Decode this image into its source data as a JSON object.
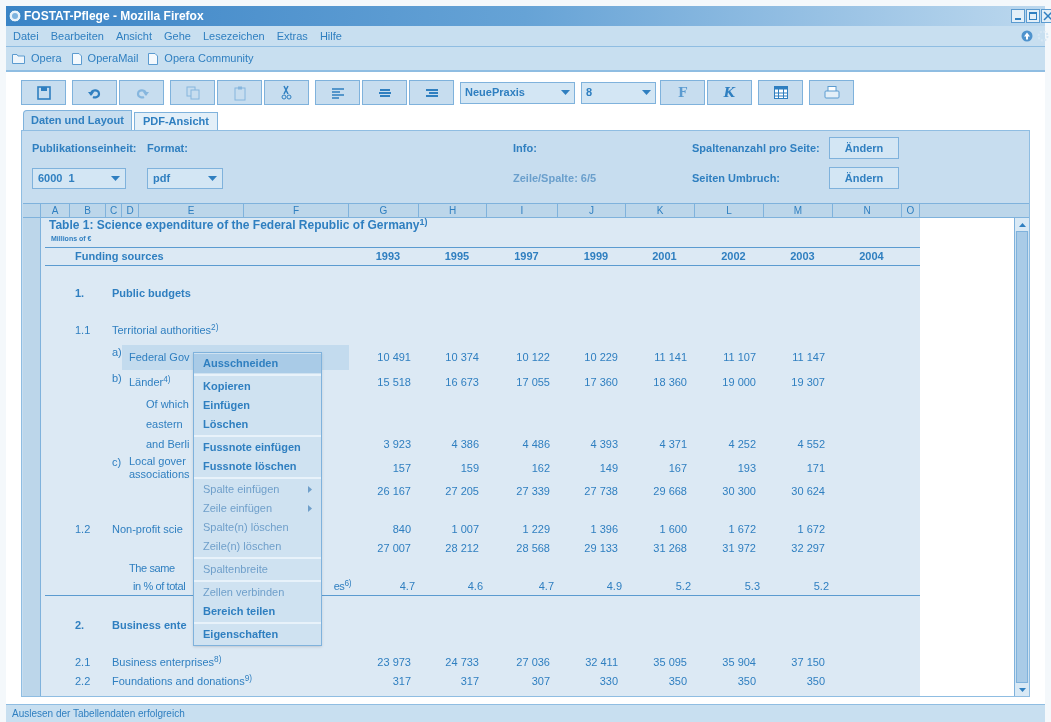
{
  "window": {
    "title": "FOSTAT-Pflege - Mozilla Firefox"
  },
  "menu": [
    "Datei",
    "Bearbeiten",
    "Ansicht",
    "Gehe",
    "Lesezeichen",
    "Extras",
    "Hilfe"
  ],
  "bookmarks": [
    {
      "kind": "folder",
      "label": "Opera"
    },
    {
      "kind": "page",
      "label": "OperaMail"
    },
    {
      "kind": "page",
      "label": "Opera Community"
    }
  ],
  "toolbar": {
    "font": "NeuePraxis",
    "size": "8",
    "bold": "F",
    "italic": "K"
  },
  "tabs": [
    {
      "label": "Daten und Layout",
      "selected": true
    },
    {
      "label": "PDF-Ansicht",
      "selected": false
    }
  ],
  "form": {
    "unit_label": "Publikationseinheit:",
    "unit_value": "6000  1",
    "format_label": "Format:",
    "format_value": "pdf",
    "info_label": "Info:",
    "info_value": "Zeile/Spalte: 6/5",
    "columns_label": "Spaltenanzahl pro Seite:",
    "columns_button": "Ändern",
    "break_label": "Seiten Umbruch:",
    "break_button": "Ändern"
  },
  "sheet": {
    "columns": [
      "A",
      "B",
      "C",
      "D",
      "E",
      "F",
      "G",
      "H",
      "I",
      "J",
      "K",
      "L",
      "M",
      "N",
      "O"
    ],
    "rows": [
      {
        "kind": "title",
        "text": "Table 1:  Science expenditure of the Federal Republic of Germany$^{1)}$"
      },
      {
        "kind": "unit",
        "text": "Millions of €"
      },
      {
        "kind": "header",
        "text": "Funding sources",
        "years": [
          "1993",
          "1995",
          "1997",
          "1999",
          "2001",
          "2002",
          "2003",
          "2004"
        ]
      },
      {
        "kind": "section",
        "number": "1.",
        "text": "Public budgets"
      },
      {
        "kind": "group",
        "number": "1.1",
        "text": "Territorial authorities$^{2)}$"
      },
      {
        "kind": "sub",
        "letter": "a)",
        "text": "Federal Gov",
        "selected": true,
        "values": [
          "10 491",
          "10 374",
          "10 122",
          "10 229",
          "11 141",
          "11 107",
          "11 147"
        ]
      },
      {
        "kind": "sub",
        "letter": "b)",
        "text": "Länder$^{4)}$",
        "selected": false,
        "values": [
          "15 518",
          "16 673",
          "17 055",
          "17 360",
          "18 360",
          "19 000",
          "19 307"
        ]
      },
      {
        "kind": "note",
        "text": "Of which"
      },
      {
        "kind": "note",
        "text": "eastern"
      },
      {
        "kind": "note",
        "text": "and Berli",
        "values": [
          "3 923",
          "4 386",
          "4 486",
          "4 393",
          "4 371",
          "4 252",
          "4 552"
        ]
      },
      {
        "kind": "sub",
        "letter": "c)",
        "text": "Local gover",
        "text2": "associations",
        "selected": false,
        "values": [
          "157",
          "159",
          "162",
          "149",
          "167",
          "193",
          "171"
        ]
      },
      {
        "kind": "total",
        "values": [
          "26 167",
          "27 205",
          "27 339",
          "27 738",
          "29 668",
          "30 300",
          "30 624"
        ]
      },
      {
        "kind": "group",
        "number": "1.2",
        "text": "Non-profit scie",
        "values": [
          "840",
          "1 007",
          "1 229",
          "1 396",
          "1 600",
          "1 672",
          "1 672"
        ]
      },
      {
        "kind": "total",
        "values": [
          "27 007",
          "28 212",
          "28 568",
          "29 133",
          "31 268",
          "31 972",
          "32 297"
        ]
      },
      {
        "kind": "subnote",
        "text": "The same"
      },
      {
        "kind": "subnote",
        "text": "in % of total",
        "tail": "es$^{6)}$",
        "values": [
          "4.7",
          "4.6",
          "4.7",
          "4.9",
          "5.2",
          "5.3",
          "5.2"
        ]
      },
      {
        "kind": "section",
        "number": "2.",
        "text": "Business ente"
      },
      {
        "kind": "group",
        "number": "2.1",
        "text": "Business enterprises$^{8)}$",
        "values": [
          "23 973",
          "24 733",
          "27 036",
          "32 411",
          "35 095",
          "35 904",
          "37 150"
        ]
      },
      {
        "kind": "group",
        "number": "2.2",
        "text": "Foundations and donations$^{9)}$",
        "values": [
          "317",
          "317",
          "307",
          "330",
          "350",
          "350",
          "350"
        ]
      }
    ]
  },
  "context_menu": [
    [
      {
        "label": "Ausschneiden",
        "selected": true,
        "disabled": false
      }
    ],
    [
      {
        "label": "Kopieren",
        "selected": false,
        "disabled": false
      },
      {
        "label": "Einfügen",
        "selected": false,
        "disabled": false
      },
      {
        "label": "Löschen",
        "selected": false,
        "disabled": false
      }
    ],
    [
      {
        "label": "Fussnote einfügen",
        "selected": false,
        "disabled": false
      },
      {
        "label": "Fussnote löschen",
        "selected": false,
        "disabled": false
      }
    ],
    [
      {
        "label": "Spalte einfügen",
        "selected": false,
        "disabled": true,
        "submenu": true
      },
      {
        "label": "Zeile einfügen",
        "selected": false,
        "disabled": true,
        "submenu": true
      },
      {
        "label": "Spalte(n) löschen",
        "selected": false,
        "disabled": true
      },
      {
        "label": "Zeile(n) löschen",
        "selected": false,
        "disabled": true
      }
    ],
    [
      {
        "label": "Spaltenbreite",
        "selected": false,
        "disabled": true
      }
    ],
    [
      {
        "label": "Zellen verbinden",
        "selected": false,
        "disabled": true
      },
      {
        "label": "Bereich teilen",
        "selected": false,
        "disabled": false
      }
    ],
    [
      {
        "label": "Eigenschaften",
        "selected": false,
        "disabled": false
      }
    ]
  ],
  "status_bar": "Auslesen der Tabellendaten erfolgreich"
}
